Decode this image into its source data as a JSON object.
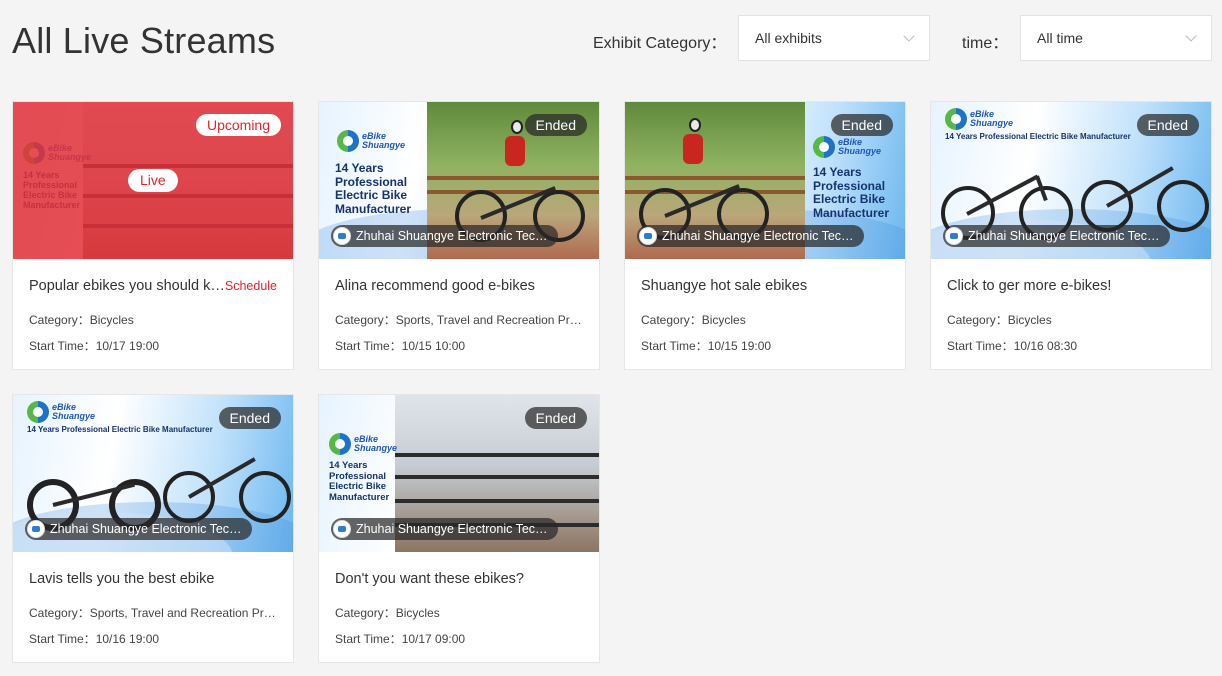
{
  "page": {
    "title": "All Live Streams"
  },
  "filters": {
    "category_label": "Exhibit Category：",
    "category_value": "All exhibits",
    "time_label": "time：",
    "time_value": "All time"
  },
  "colors": {
    "accent_red": "#e0262b",
    "badge_dark": "#3a3a3a"
  },
  "branding": {
    "logo_line1": "eBike",
    "logo_line2": "Shuangye",
    "tagline": "14 Years Professional Electric Bike Manufacturer"
  },
  "cards": [
    {
      "status": "Upcoming",
      "live": "Live",
      "title": "Popular ebikes you should know about",
      "schedule": "Schedule",
      "category_label": "Category：",
      "category": "Bicycles",
      "time_label": "Start Time：",
      "start_time": "10/17 19:00"
    },
    {
      "status": "Ended",
      "company": "Zhuhai Shuangye Electronic Technology Co., Ltd.",
      "title": "Alina recommend good e-bikes",
      "category_label": "Category：",
      "category": "Sports, Travel and Recreation Products",
      "time_label": "Start Time：",
      "start_time": "10/15 10:00"
    },
    {
      "status": "Ended",
      "company": "Zhuhai Shuangye Electronic Technology Co., Ltd.",
      "title": "Shuangye hot sale ebikes",
      "category_label": "Category：",
      "category": "Bicycles",
      "time_label": "Start Time：",
      "start_time": "10/15 19:00"
    },
    {
      "status": "Ended",
      "company": "Zhuhai Shuangye Electronic Technology Co., Ltd.",
      "title": "Click to ger more e-bikes!",
      "category_label": "Category：",
      "category": "Bicycles",
      "time_label": "Start Time：",
      "start_time": "10/16 08:30"
    },
    {
      "status": "Ended",
      "company": "Zhuhai Shuangye Electronic Technology Co., Ltd.",
      "title": "Lavis tells you the best ebike",
      "category_label": "Category：",
      "category": "Sports, Travel and Recreation Products",
      "time_label": "Start Time：",
      "start_time": "10/16 19:00"
    },
    {
      "status": "Ended",
      "company": "Zhuhai Shuangye Electronic Technology Co., Ltd.",
      "title": "Don't you want these ebikes?",
      "category_label": "Category：",
      "category": "Bicycles",
      "time_label": "Start Time：",
      "start_time": "10/17 09:00"
    }
  ]
}
